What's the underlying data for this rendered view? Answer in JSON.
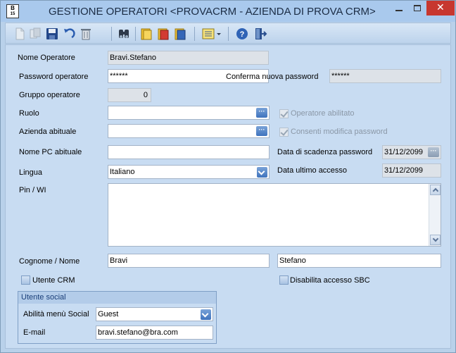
{
  "window": {
    "title": "GESTIONE OPERATORI <PROVACRM - AZIENDA DI PROVA CRM>",
    "app_icon": {
      "text": "B",
      "sub": "15"
    },
    "controls": {
      "close_label": "✕"
    }
  },
  "toolbar": {
    "icons": [
      "new-icon",
      "copy-icon",
      "save-icon",
      "undo-icon",
      "delete-icon",
      "binoculars-search-icon",
      "folder-yellow-icon",
      "book-red-icon",
      "book-blue-icon",
      "list-options-icon",
      "help-icon",
      "exit-icon"
    ]
  },
  "form": {
    "nome_operatore": {
      "label": "Nome Operatore",
      "value": "Bravi.Stefano"
    },
    "password": {
      "label": "Password operatore",
      "value": "******"
    },
    "conferma_password": {
      "label": "Conferma nuova password",
      "value": "******"
    },
    "gruppo": {
      "label": "Gruppo operatore",
      "value": "0"
    },
    "ruolo": {
      "label": "Ruolo",
      "value": "",
      "button": "···"
    },
    "operatore_abilitato": {
      "label": "Operatore abilitato",
      "checked": true,
      "disabled": true
    },
    "azienda": {
      "label": "Azienda abituale",
      "value": "",
      "button": "···"
    },
    "consenti_modifica": {
      "label": "Consenti modifica password",
      "checked": true,
      "disabled": true
    },
    "nome_pc": {
      "label": "Nome PC abituale",
      "value": ""
    },
    "scadenza_password": {
      "label": "Data di scadenza password",
      "value": "31/12/2099",
      "button": "···"
    },
    "lingua": {
      "label": "Lingua",
      "value": "Italiano"
    },
    "ultimo_accesso": {
      "label": "Data ultimo accesso",
      "value": "31/12/2099"
    },
    "pin": {
      "label": "Pin / WI",
      "value": ""
    },
    "cognome_nome": {
      "label": "Cognome /  Nome",
      "cognome": "Bravi",
      "nome": "Stefano"
    },
    "utente_crm": {
      "label": "Utente CRM",
      "checked": false
    },
    "disabilita_sbc": {
      "label": "Disabilita accesso SBC",
      "checked": false
    },
    "utente_social": {
      "title": "Utente social",
      "menu_social": {
        "label": "Abilità menù Social",
        "value": "Guest"
      },
      "email": {
        "label": "E-mail",
        "value": "bravi.stefano@bra.com"
      }
    }
  }
}
